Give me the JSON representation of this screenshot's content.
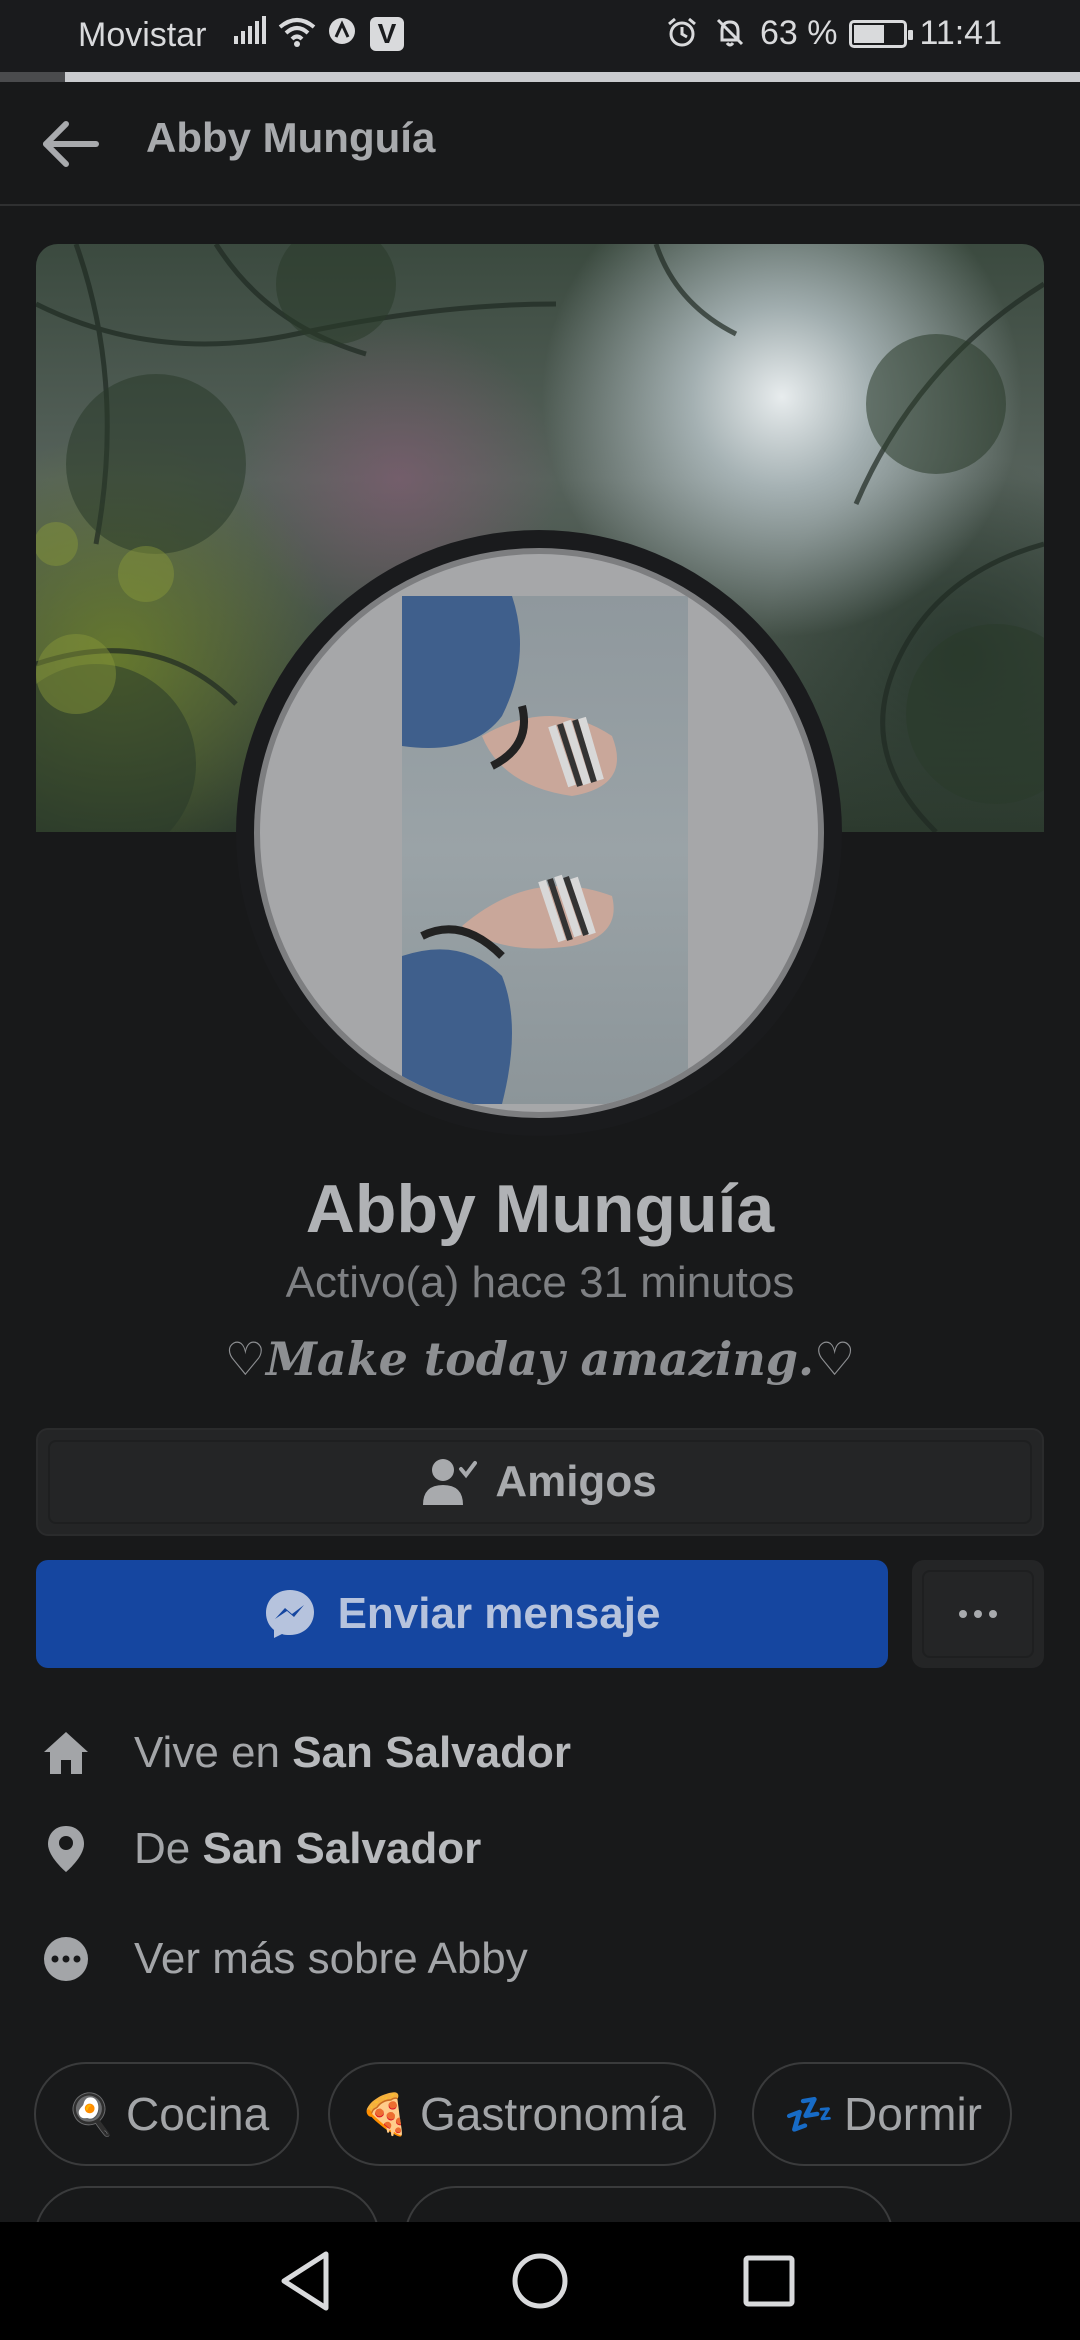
{
  "status_bar": {
    "carrier": "Movistar",
    "battery_percent": "63 %",
    "battery_level": 0.63,
    "time": "11:41",
    "icons": [
      "signal-icon",
      "wifi-icon",
      "data-saver-icon",
      "app-v-icon",
      "alarm-icon",
      "bell-off-icon",
      "battery-icon"
    ]
  },
  "page_load_progress": 0.06,
  "header": {
    "title": "Abby Munguía",
    "back_icon": "arrow-left-icon"
  },
  "profile": {
    "name": "Abby Munguía",
    "status": "Activo(a) hace 31 minutos",
    "bio": "♡𝑴𝒂𝒌𝒆 𝒕𝒐𝒅𝒂𝒚 𝒂𝒎𝒂𝒛𝒊𝒏𝒈.♡"
  },
  "actions": {
    "friends_label": "Amigos",
    "message_label": "Enviar mensaje",
    "more_label": "···"
  },
  "info": {
    "lives_prefix": "Vive en ",
    "lives_city": "San Salvador",
    "from_prefix": "De ",
    "from_city": "San Salvador",
    "see_more": "Ver más sobre Abby"
  },
  "interests": [
    {
      "emoji": "🍳",
      "label": "Cocina"
    },
    {
      "emoji": "🍕",
      "label": "Gastronomía"
    },
    {
      "emoji": "💤",
      "label": "Dormir"
    }
  ],
  "colors": {
    "background": "#18191a",
    "message_button": "#1546a0",
    "card": "#242526"
  }
}
